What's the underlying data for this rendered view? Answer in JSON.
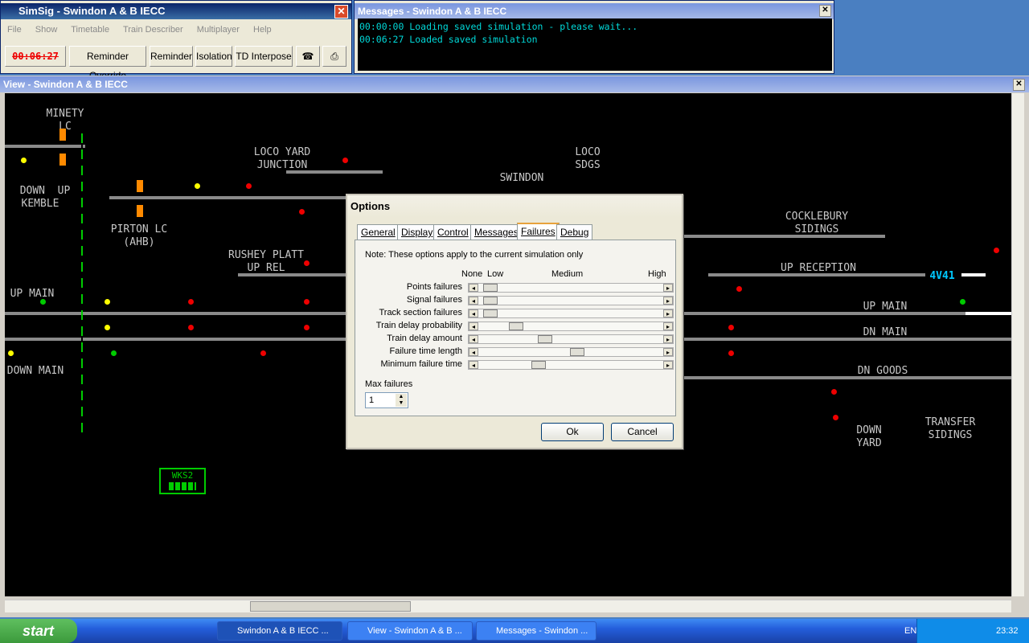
{
  "sim_window": {
    "title": "SimSig - Swindon A & B IECC",
    "menu": [
      "File",
      "Show",
      "Timetable",
      "Train Describer",
      "Multiplayer",
      "Help"
    ],
    "clock": "00:06:27",
    "buttons": [
      "Reminder Override",
      "Reminder",
      "Isolation",
      "TD Interpose"
    ]
  },
  "msg_window": {
    "title": "Messages - Swindon A & B IECC",
    "lines": [
      "00:00:00 Loading saved simulation - please wait...",
      "00:06:27 Loaded saved simulation"
    ]
  },
  "view_window": {
    "title": "View - Swindon A & B IECC"
  },
  "labels": {
    "minety": "MINETY\nLC",
    "loco_yard": "LOCO YARD\nJUNCTION",
    "swindon": "SWINDON",
    "loco_sdgs": "LOCO\nSDGS",
    "down_up": "DOWN  UP",
    "kemble": "KEMBLE",
    "pirton": "PIRTON LC\n(AHB)",
    "cocklebury": "COCKLEBURY\nSIDINGS",
    "rushey": "RUSHEY PLATT\nUP REL",
    "up_main_left": "UP MAIN",
    "up_reception": "UP RECEPTION",
    "up_main_right": "UP MAIN",
    "dn_main": "DN MAIN",
    "dn_goods": "DN GOODS",
    "down_main_left": "DOWN MAIN",
    "down_yard": "DOWN\nYARD",
    "transfer": "TRANSFER\nSIDINGS",
    "wks": "WKS2",
    "headcode": "4V41"
  },
  "dialog": {
    "title": "Options",
    "tabs": [
      "General",
      "Display",
      "Control",
      "Messages",
      "Failures",
      "Debug"
    ],
    "active_tab": "Failures",
    "note": "Note: These options apply to the current simulation only",
    "scale": [
      "None",
      "Low",
      "Medium",
      "High"
    ],
    "rows": [
      {
        "label": "Points failures",
        "level": 0.03
      },
      {
        "label": "Signal failures",
        "level": 0.03
      },
      {
        "label": "Track section failures",
        "level": 0.03
      },
      {
        "label": "Train delay probability",
        "level": 0.18
      },
      {
        "label": "Train delay amount",
        "level": 0.35
      },
      {
        "label": "Failure time length",
        "level": 0.54
      },
      {
        "label": "Minimum failure time",
        "level": 0.31
      }
    ],
    "max_failures_label": "Max failures",
    "max_failures": "1",
    "ok": "Ok",
    "cancel": "Cancel"
  },
  "taskbar": {
    "start": "start",
    "tasks": [
      "Swindon A & B IECC ...",
      "View - Swindon A & B ...",
      "Messages - Swindon ..."
    ],
    "lang": "EN",
    "time": "23:32"
  }
}
